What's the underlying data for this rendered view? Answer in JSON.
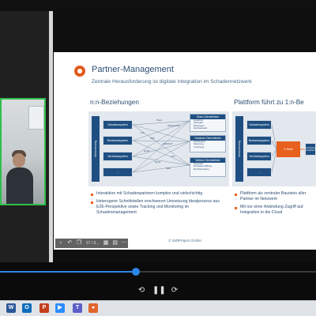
{
  "slide": {
    "title": "Partner-Management",
    "subtitle": "Zentrale Herausforderung ist digitale Integration im Schadennetzwerk",
    "left_heading": "n:n-Beziehungen",
    "right_heading": "Plattform führt zu 1:n-Be",
    "left_diagram": {
      "side_label": "Versicherung",
      "systems": [
        "Schadensystem",
        "Bestandssystem",
        "Vertriebssystem",
        "..."
      ],
      "flows": [
        "Preis",
        "Webservice",
        "Fax",
        "XML",
        "EDIFACT",
        "Email",
        "TXT",
        "Excel",
        "SAP"
      ],
      "service_groups": [
        {
          "title": "Motor-Dienstleister",
          "items": [
            "Gutachter",
            "Werkstatt",
            "Mietwagen",
            "Rechtsanwalt"
          ]
        },
        {
          "title": "Gebäude-Dienstleister",
          "items": [
            "Handwerker",
            "Sanierung",
            "Trocknung"
          ]
        },
        {
          "title": "Weitere Dienstleister",
          "items": [
            "Reparatur",
            "Ersatzbeschaffung",
            "Rechtsberatung"
          ]
        }
      ]
    },
    "right_diagram": {
      "side_label": "Versicherung",
      "systems": [
        "Schadensystem",
        "Bestandssystem",
        "Vertriebssystem",
        "..."
      ],
      "hub_label": "X-Suite",
      "partner_label": "Versicherungs Gutachter"
    },
    "bullets_left": [
      "Interaktion mit Schadenpartnern komplex und vielschichtig",
      "Heterogene Schnittstellen erschweren Umsetzung Idealprozess aus E2E-Perspektive sowie Tracking und Monitoring im Schadenmanagement"
    ],
    "bullets_right": [
      "Plattform als zentraler Baustein aller Partner im Netzwerk",
      "Mit nur einer Anbindung Zugriff auf Integration in die Cloud"
    ],
    "footer": "© SoftProject GmbH"
  },
  "slide_toolbar": {
    "page_label": "17 / 3...",
    "icons": [
      "back-icon",
      "undo-icon",
      "copy-icon",
      "page-indicator",
      "grid-icon",
      "chart-icon",
      "more-icon"
    ]
  },
  "player": {
    "progress_fraction": 0.43,
    "accent_color": "#2b86e8"
  },
  "taskbar": {
    "apps": [
      {
        "name": "word",
        "glyph": "W",
        "color": "#2b579a"
      },
      {
        "name": "outlook",
        "glyph": "O",
        "color": "#0f6cbd"
      },
      {
        "name": "powerpoint",
        "glyph": "P",
        "color": "#c43e1c"
      },
      {
        "name": "zoom",
        "glyph": "▶",
        "color": "#2d8cff"
      },
      {
        "name": "teams",
        "glyph": "T",
        "color": "#5b5fc7"
      },
      {
        "name": "browser",
        "glyph": "●",
        "color": "#e0662b"
      }
    ]
  }
}
